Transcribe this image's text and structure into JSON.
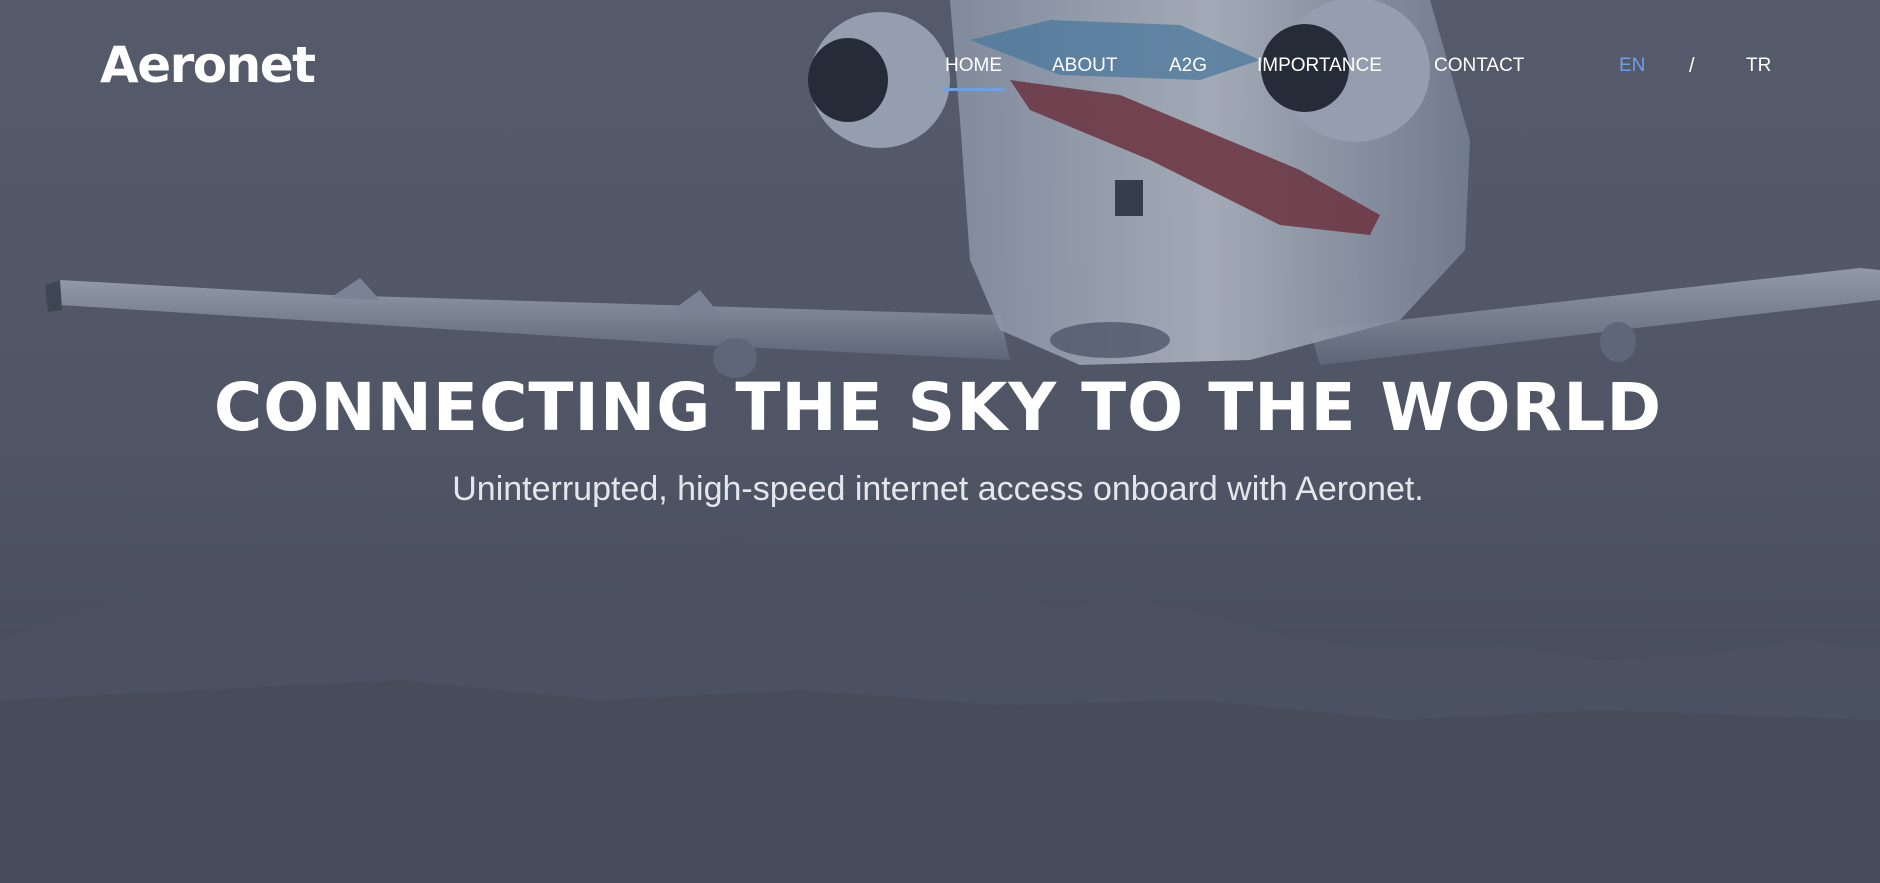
{
  "brand": {
    "logo_text": "Aeronet"
  },
  "nav": {
    "items": [
      {
        "label": "HOME",
        "active": true
      },
      {
        "label": "ABOUT",
        "active": false
      },
      {
        "label": "A2G",
        "active": false
      },
      {
        "label": "IMPORTANCE",
        "active": false
      },
      {
        "label": "CONTACT",
        "active": false
      }
    ]
  },
  "language": {
    "options": [
      {
        "label": "EN",
        "active": true
      },
      {
        "label": "TR",
        "active": false
      }
    ],
    "separator": "/"
  },
  "hero": {
    "headline": "CONNECTING THE SKY TO THE WORLD",
    "subline": "Uninterrupted, high-speed internet access onboard with Aeronet.",
    "background_image": "business-jet-over-mountains"
  },
  "colors": {
    "accent": "#6f9ee3",
    "text": "#ffffff",
    "overlay": "#4a5160"
  }
}
